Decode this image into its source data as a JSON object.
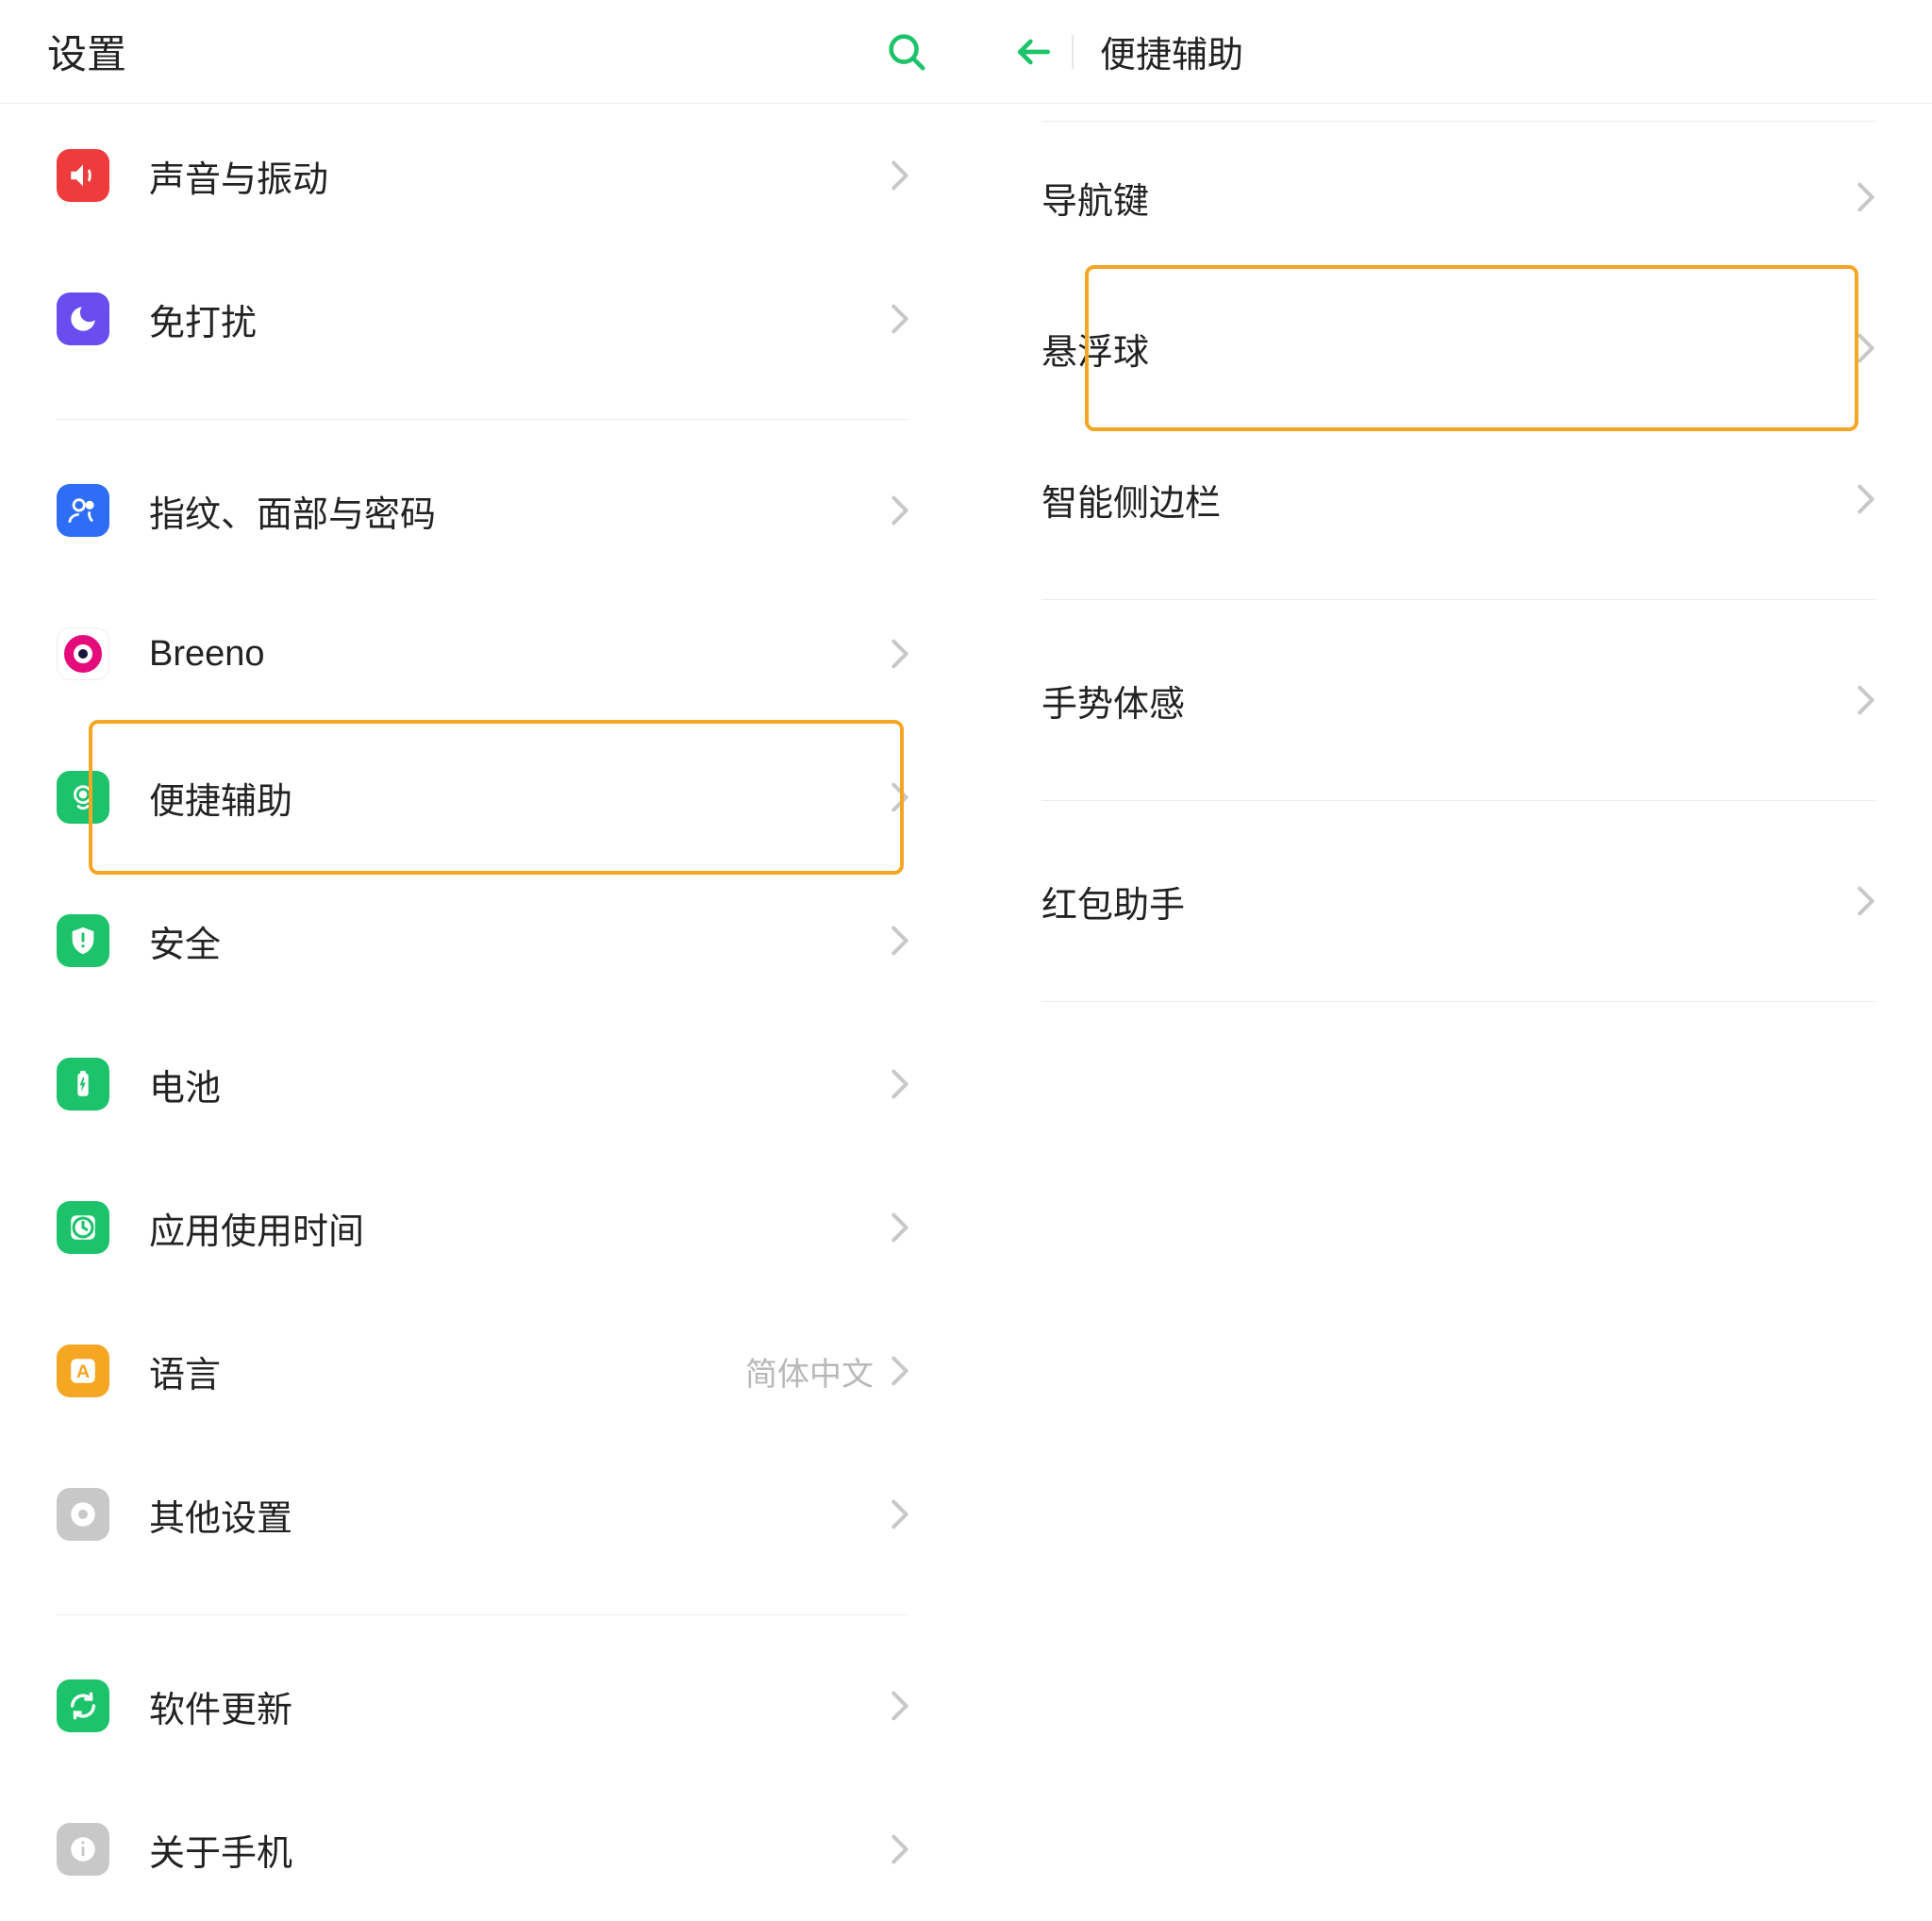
{
  "left_panel": {
    "title": "设置",
    "items": [
      {
        "id": "sound",
        "label": "声音与振动",
        "icon_bg": "#ef3b3b",
        "value": "",
        "highlighted": false
      },
      {
        "id": "dnd",
        "label": "免打扰",
        "icon_bg": "#6a4df0",
        "value": "",
        "highlighted": false
      },
      {
        "divider": true
      },
      {
        "id": "biometrics",
        "label": "指纹、面部与密码",
        "icon_bg": "#2e6df6",
        "value": "",
        "highlighted": false
      },
      {
        "id": "breeno",
        "label": "Breeno",
        "icon_bg": "#ffffff",
        "value": "",
        "highlighted": false
      },
      {
        "id": "assist",
        "label": "便捷辅助",
        "icon_bg": "#1dc36b",
        "value": "",
        "highlighted": true
      },
      {
        "id": "security",
        "label": "安全",
        "icon_bg": "#1dc36b",
        "value": "",
        "highlighted": false
      },
      {
        "id": "battery",
        "label": "电池",
        "icon_bg": "#1dc36b",
        "value": "",
        "highlighted": false
      },
      {
        "id": "app-usage",
        "label": "应用使用时间",
        "icon_bg": "#1dc36b",
        "value": "",
        "highlighted": false
      },
      {
        "id": "language",
        "label": "语言",
        "icon_bg": "#f5a623",
        "value": "简体中文",
        "highlighted": false
      },
      {
        "id": "other",
        "label": "其他设置",
        "icon_bg": "#c8c8c8",
        "value": "",
        "highlighted": false
      },
      {
        "divider": true
      },
      {
        "id": "update",
        "label": "软件更新",
        "icon_bg": "#1dc36b",
        "value": "",
        "highlighted": false
      },
      {
        "id": "about",
        "label": "关于手机",
        "icon_bg": "#c8c8c8",
        "value": "",
        "highlighted": false
      }
    ]
  },
  "right_panel": {
    "title": "便捷辅助",
    "items": [
      {
        "id": "nav-keys",
        "label": "导航键",
        "highlighted": false,
        "sep_after": false
      },
      {
        "id": "float-ball",
        "label": "悬浮球",
        "highlighted": true,
        "sep_after": false
      },
      {
        "id": "smart-side",
        "label": "智能侧边栏",
        "highlighted": false,
        "sep_after": true
      },
      {
        "id": "gesture",
        "label": "手势体感",
        "highlighted": false,
        "sep_after": true
      },
      {
        "id": "red-packet",
        "label": "红包助手",
        "highlighted": false,
        "sep_after": true
      }
    ]
  },
  "colors": {
    "accent": "#1dc36b",
    "highlight_border": "#f5a623"
  }
}
